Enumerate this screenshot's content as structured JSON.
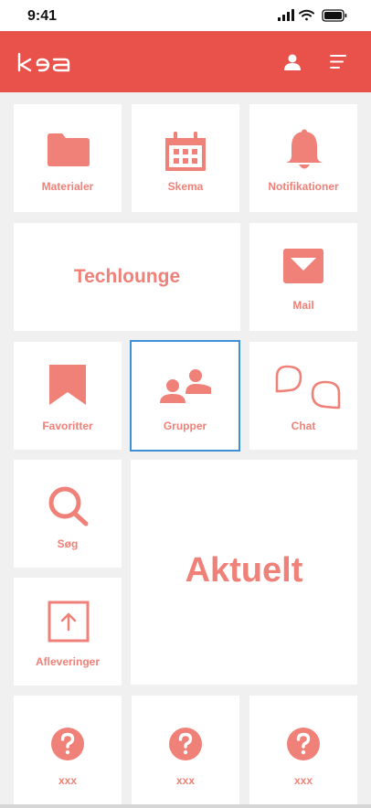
{
  "status_bar": {
    "time": "9:41"
  },
  "header": {
    "logo_text": "kea"
  },
  "colors": {
    "brand": "#e8524a",
    "tile_accent": "#ef8178",
    "selected_outline": "#3d8fd6",
    "background": "#f0f0f0"
  },
  "tiles": {
    "materialer": {
      "label": "Materialer",
      "icon": "folder-icon"
    },
    "skema": {
      "label": "Skema",
      "icon": "calendar-icon"
    },
    "notifikationer": {
      "label": "Notifikationer",
      "icon": "bell-icon"
    },
    "techlounge": {
      "label": "Techlounge"
    },
    "mail": {
      "label": "Mail",
      "icon": "mail-icon"
    },
    "favoritter": {
      "label": "Favoritter",
      "icon": "bookmark-icon"
    },
    "grupper": {
      "label": "Grupper",
      "icon": "group-icon",
      "selected": true
    },
    "chat": {
      "label": "Chat",
      "icon": "chat-bubbles-icon"
    },
    "soeg": {
      "label": "Søg",
      "icon": "search-icon"
    },
    "aktuelt": {
      "label": "Aktuelt"
    },
    "afleveringer": {
      "label": "Afleveringer",
      "icon": "upload-icon"
    },
    "xxx1": {
      "label": "xxx",
      "icon": "question-icon"
    },
    "xxx2": {
      "label": "xxx",
      "icon": "question-icon"
    },
    "xxx3": {
      "label": "xxx",
      "icon": "question-icon"
    }
  }
}
